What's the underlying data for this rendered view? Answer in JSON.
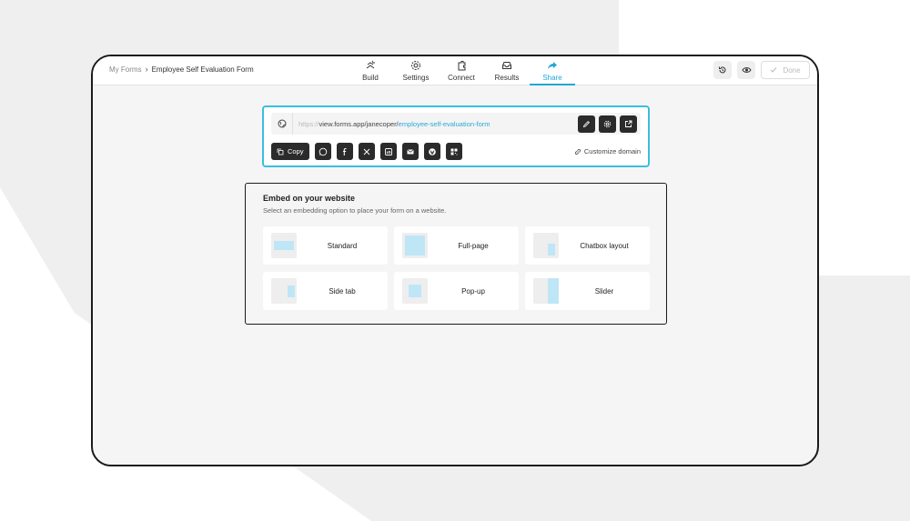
{
  "breadcrumb": {
    "root": "My Forms",
    "separator": "›",
    "current": "Employee Self Evaluation Form"
  },
  "nav": {
    "tabs": [
      {
        "label": "Build",
        "icon": "build-icon"
      },
      {
        "label": "Settings",
        "icon": "settings-icon"
      },
      {
        "label": "Connect",
        "icon": "connect-icon"
      },
      {
        "label": "Results",
        "icon": "results-icon"
      },
      {
        "label": "Share",
        "icon": "share-icon",
        "active": true
      }
    ]
  },
  "actions": {
    "done_label": "Done",
    "history_icon": "history-icon",
    "preview_icon": "eye-icon"
  },
  "share": {
    "url_protocol": "https://",
    "url_host": "view.forms.app/janecoper/",
    "url_slug": "employee-self-evaluation-form",
    "copy_label": "Copy",
    "customize_label": "Customize domain",
    "social": [
      "whatsapp-icon",
      "facebook-icon",
      "x-icon",
      "linkedin-icon",
      "email-icon",
      "wordpress-icon",
      "qr-code-icon"
    ]
  },
  "embed": {
    "title": "Embed on your website",
    "subtitle": "Select an embedding option to place your form on a website.",
    "options": [
      {
        "label": "Standard"
      },
      {
        "label": "Full-page"
      },
      {
        "label": "Chatbox layout"
      },
      {
        "label": "Side tab"
      },
      {
        "label": "Pop-up"
      },
      {
        "label": "Slider"
      }
    ]
  },
  "colors": {
    "accent": "#1fa7d9",
    "dark": "#2b2b2b",
    "thumb_fill": "#bfe6f7"
  }
}
